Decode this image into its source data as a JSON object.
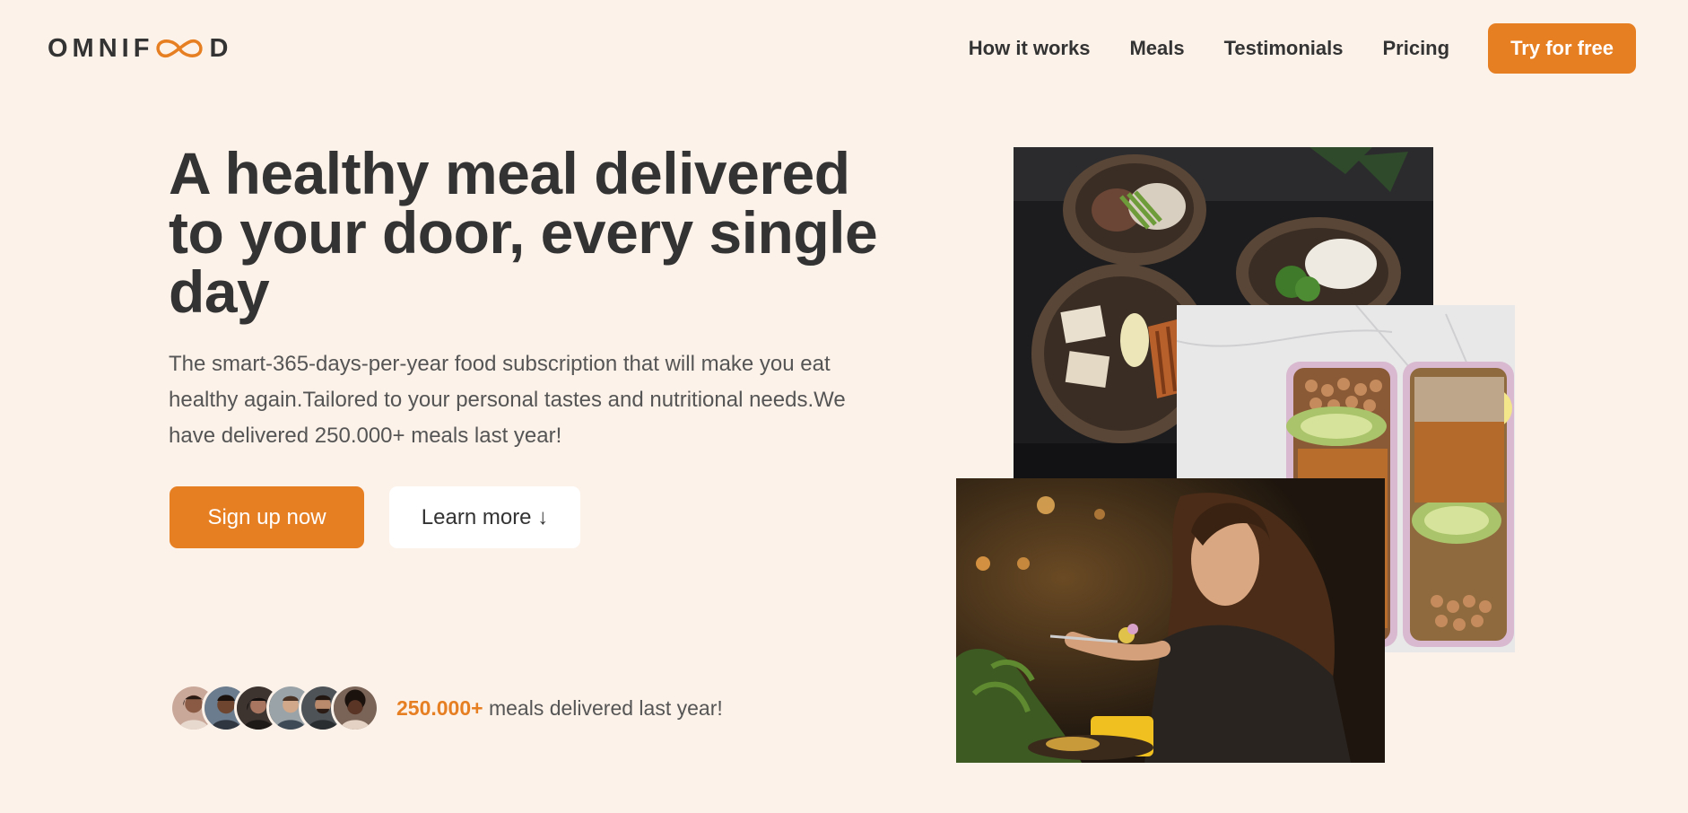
{
  "header": {
    "logo_text_left": "OMNIF",
    "logo_text_right": "D",
    "logo_icon": "infinity-icon",
    "nav": [
      {
        "label": "How it works"
      },
      {
        "label": "Meals"
      },
      {
        "label": "Testimonials"
      },
      {
        "label": "Pricing"
      }
    ],
    "cta_label": "Try for free"
  },
  "hero": {
    "title": "A healthy meal delivered to your door, every single day",
    "description": "The smart-365-days-per-year food subscription that will make you eat healthy again.Tailored to your personal tastes and nutritional needs.We have delivered 250.000+ meals last year!",
    "primary_button": "Sign up now",
    "secondary_button": "Learn more ↓"
  },
  "delivered": {
    "count": "250.000+",
    "text": " meals delivered last year!",
    "avatar_count": 6
  },
  "images": {
    "bowls": "food-bowls-photo",
    "boxes": "meal-prep-boxes-photo",
    "woman": "woman-eating-photo"
  },
  "colors": {
    "accent": "#e67e22",
    "background": "#fdf2e9",
    "text_dark": "#333333",
    "text_body": "#555555"
  }
}
